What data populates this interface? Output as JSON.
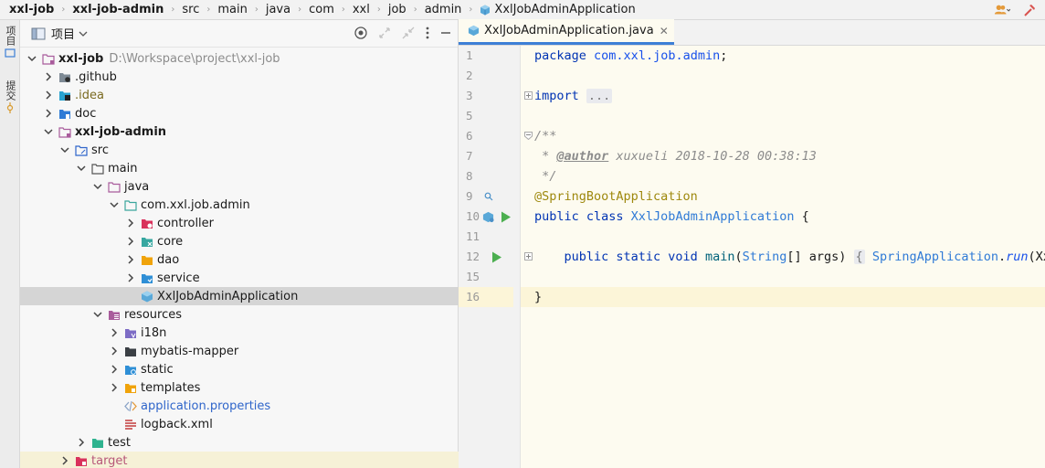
{
  "breadcrumb": [
    "xxl-job",
    "xxl-job-admin",
    "src",
    "main",
    "java",
    "com",
    "xxl",
    "job",
    "admin",
    "XxlJobAdminApplication"
  ],
  "toolstrip": {
    "project_label": "项目",
    "commit_label": "提交"
  },
  "project_panel": {
    "title": "项目"
  },
  "tree": [
    {
      "label": "xxl-job",
      "path": "D:\\Workspace\\project\\xxl-job"
    },
    {
      "label": ".github"
    },
    {
      "label": ".idea"
    },
    {
      "label": "doc"
    },
    {
      "label": "xxl-job-admin"
    },
    {
      "label": "src"
    },
    {
      "label": "main"
    },
    {
      "label": "java"
    },
    {
      "label": "com.xxl.job.admin"
    },
    {
      "label": "controller"
    },
    {
      "label": "core"
    },
    {
      "label": "dao"
    },
    {
      "label": "service"
    },
    {
      "label": "XxlJobAdminApplication"
    },
    {
      "label": "resources"
    },
    {
      "label": "i18n"
    },
    {
      "label": "mybatis-mapper"
    },
    {
      "label": "static"
    },
    {
      "label": "templates"
    },
    {
      "label": "application.properties"
    },
    {
      "label": "logback.xml"
    },
    {
      "label": "test"
    },
    {
      "label": "target"
    }
  ],
  "editor": {
    "tab_label": "XxlJobAdminApplication.java",
    "line_numbers": [
      "1",
      "2",
      "3",
      "5",
      "6",
      "7",
      "8",
      "9",
      "10",
      "11",
      "12",
      "15",
      "16"
    ],
    "code": {
      "l1_kw": "package",
      "l1_pkg": "com.xxl.job.admin",
      "l1_end": ";",
      "l3_kw": "import",
      "l3_fold": "...",
      "l6": "/**",
      "l7_pre": " * ",
      "l7_tag": "@author",
      "l7_rest": " xuxueli 2018-10-28 00:38:13",
      "l8": " */",
      "l9": "@SpringBootApplication",
      "l10_kw": "public class ",
      "l10_cls": "XxlJobAdminApplication",
      "l10_brace": " {",
      "l12_kw": "    public static void ",
      "l12_method": "main",
      "l12_p1": "(",
      "l12_type": "String",
      "l12_p2": "[] args) ",
      "l12_fold": "{",
      "l12_sp": " ",
      "l12_cls": "SpringApplication",
      "l12_dot": ".",
      "l12_run": "run",
      "l12_rest": "(Xxl",
      "l16": "}"
    }
  }
}
